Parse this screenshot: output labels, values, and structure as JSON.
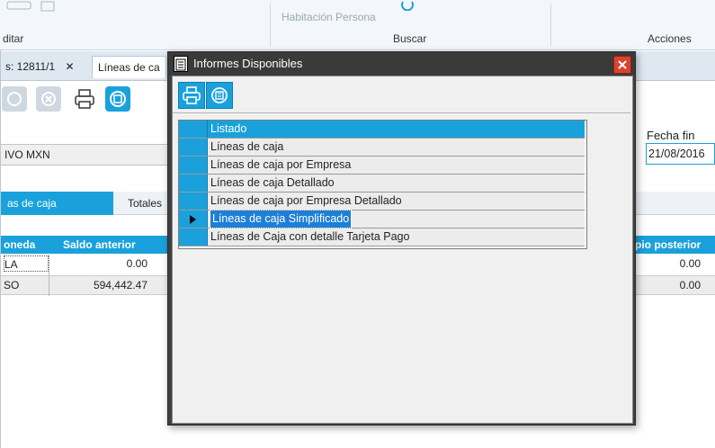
{
  "ribbon": {
    "top_label_faint": "Habitación  Persona",
    "groups": [
      "ditar",
      "Buscar",
      "Acciones"
    ]
  },
  "tabs": {
    "first": "s: 12811/1",
    "close": "✕",
    "second": "Líneas de ca"
  },
  "form": {
    "field_value": "IVO MXN",
    "fecha_fin_label": "Fecha fin",
    "fecha_fin_value": "21/08/2016"
  },
  "subtabs": [
    "as de caja",
    "Totales"
  ],
  "grid": {
    "headers": [
      "oneda",
      "Saldo anterior",
      "pio posterior"
    ],
    "rows": [
      {
        "moneda": "LA",
        "saldo": "0.00",
        "posterior": "0.00"
      },
      {
        "moneda": "SO",
        "saldo": "594,442.47",
        "posterior": "0.00"
      }
    ]
  },
  "dialog": {
    "title": "Informes Disponibles",
    "list_header": "Listado",
    "items": [
      "Líneas de caja",
      "Líneas de caja por Empresa",
      "Líneas de caja Detallado",
      "Líneas de caja por Empresa Detallado",
      "Líneas de caja Simplificado",
      "Líneas de Caja con detalle Tarjeta Pago"
    ],
    "selected_index": 4
  },
  "colors": {
    "accent": "#1aa1dc",
    "selection": "#1e7fd6",
    "dialog_frame": "#3f3f3f"
  }
}
